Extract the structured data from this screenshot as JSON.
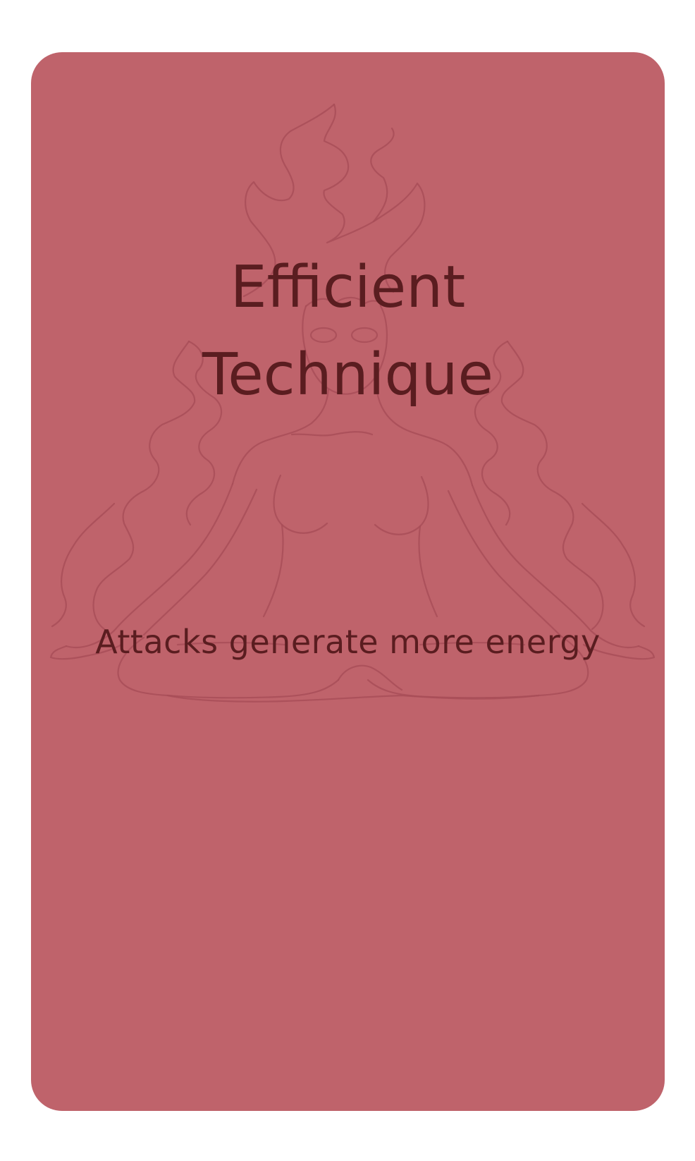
{
  "card": {
    "title_line1": "Efficient",
    "title_line2": "Technique",
    "description": "Attacks generate more energy",
    "background_color": "#bf636b",
    "text_color": "#5a1d20",
    "illustration": "meditating-figure-with-flames"
  }
}
